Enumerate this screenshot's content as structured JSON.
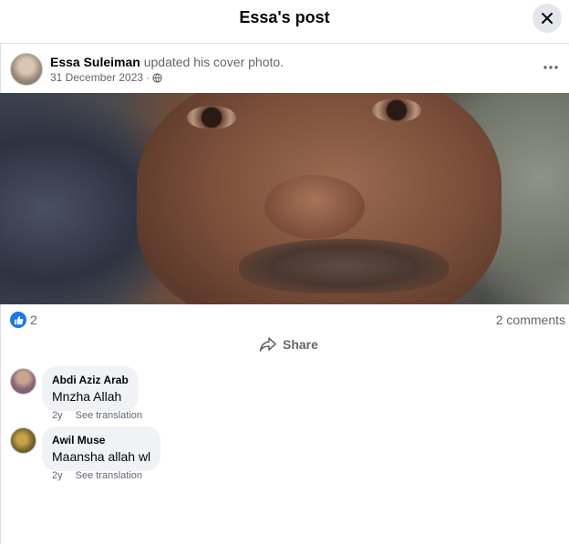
{
  "dialog": {
    "title": "Essa's post"
  },
  "post": {
    "author": "Essa Suleiman",
    "action": " updated his cover photo.",
    "date": "31 December 2023",
    "separator": "·",
    "reaction_count": "2",
    "comments_count": "2 comments",
    "share_label": "Share"
  },
  "comments": [
    {
      "name": "Abdi Aziz Arab",
      "text": "Mnzha Allah",
      "age": "2y",
      "translate": "See translation"
    },
    {
      "name": "Awil Muse",
      "text": "Maansha allah wl",
      "age": "2y",
      "translate": "See translation"
    }
  ],
  "colors": {
    "accent": "#1877f2",
    "bubble": "#f0f2f5",
    "secondary_text": "#65676b"
  }
}
